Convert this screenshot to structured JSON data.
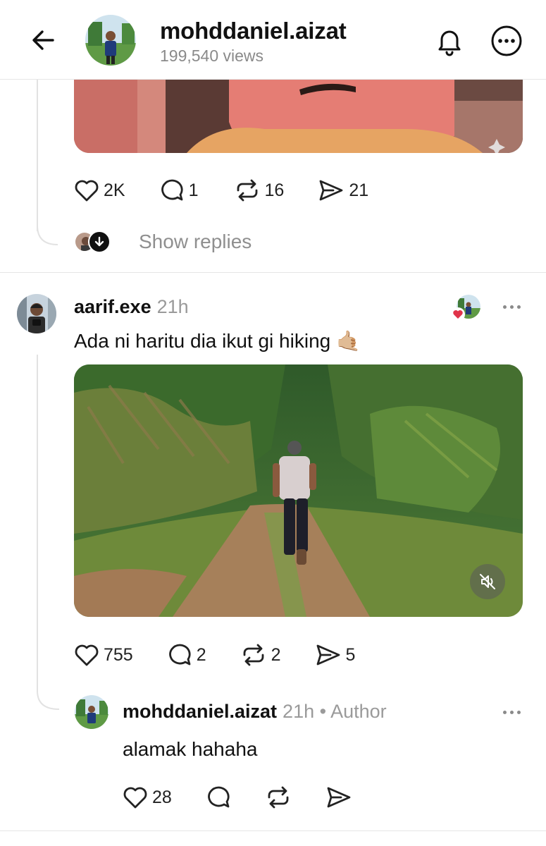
{
  "header": {
    "username": "mohddaniel.aizat",
    "views": "199,540 views"
  },
  "top_post": {
    "stats": {
      "likes": "2K",
      "comments": "1",
      "reposts": "16",
      "shares": "21"
    },
    "show_replies_label": "Show replies"
  },
  "comment": {
    "username": "aarif.exe",
    "time": "21h",
    "text": "Ada ni haritu dia ikut gi hiking",
    "emoji": "🤙🏼",
    "stats": {
      "likes": "755",
      "comments": "2",
      "reposts": "2",
      "shares": "5"
    }
  },
  "reply": {
    "username": "mohddaniel.aizat",
    "time": "21h",
    "author_label": "• Author",
    "text": "alamak hahaha",
    "stats": {
      "likes": "28"
    }
  },
  "colors": {
    "text": "#111111",
    "muted": "#8f8f8f",
    "divider": "#e6e6e6",
    "heart": "#e0334a"
  }
}
